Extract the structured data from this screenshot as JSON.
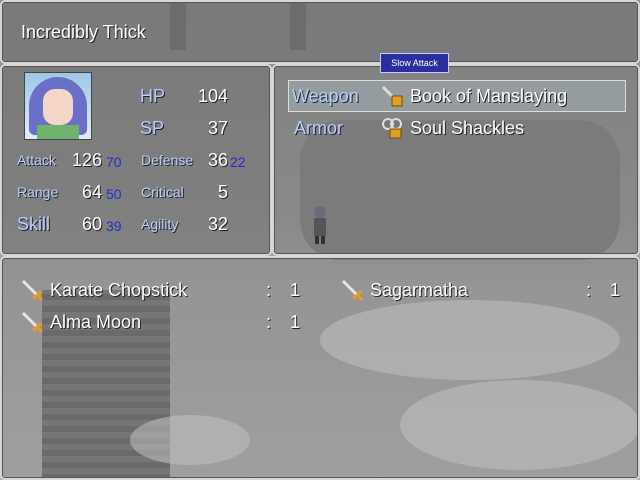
{
  "title_window": {
    "text": "Incredibly Thick"
  },
  "tooltip": {
    "text": "Slow Attack"
  },
  "actor": {
    "hp_label": "HP",
    "hp_value": "104",
    "sp_label": "SP",
    "sp_value": "37",
    "stats": [
      {
        "label": "Attack",
        "value": "126",
        "bonus": "70"
      },
      {
        "label": "Defense",
        "value": "36",
        "bonus": "22"
      },
      {
        "label": "Range",
        "value": "64",
        "bonus": "50"
      },
      {
        "label": "Critical",
        "value": "5",
        "bonus": ""
      },
      {
        "label": "Skill",
        "value": "60",
        "bonus": "39"
      },
      {
        "label": "Agility",
        "value": "32",
        "bonus": ""
      }
    ]
  },
  "equipment": [
    {
      "slot": "Weapon",
      "item": "Book of Manslaying",
      "icon": "book-icon"
    },
    {
      "slot": "Armor",
      "item": "Soul Shackles",
      "icon": "shackles-icon"
    }
  ],
  "inventory": {
    "separator": ":",
    "items": [
      {
        "name": "Karate Chopstick",
        "count": "1",
        "icon": "sword-icon"
      },
      {
        "name": "Sagarmatha",
        "count": "1",
        "icon": "sword-icon"
      },
      {
        "name": "Alma Moon",
        "count": "1",
        "icon": "sword-icon"
      }
    ]
  },
  "colors": {
    "system_text": "#b8d0ff",
    "bonus_text": "#1f2fd0",
    "tooltip_bg": "#2b2f9e"
  }
}
